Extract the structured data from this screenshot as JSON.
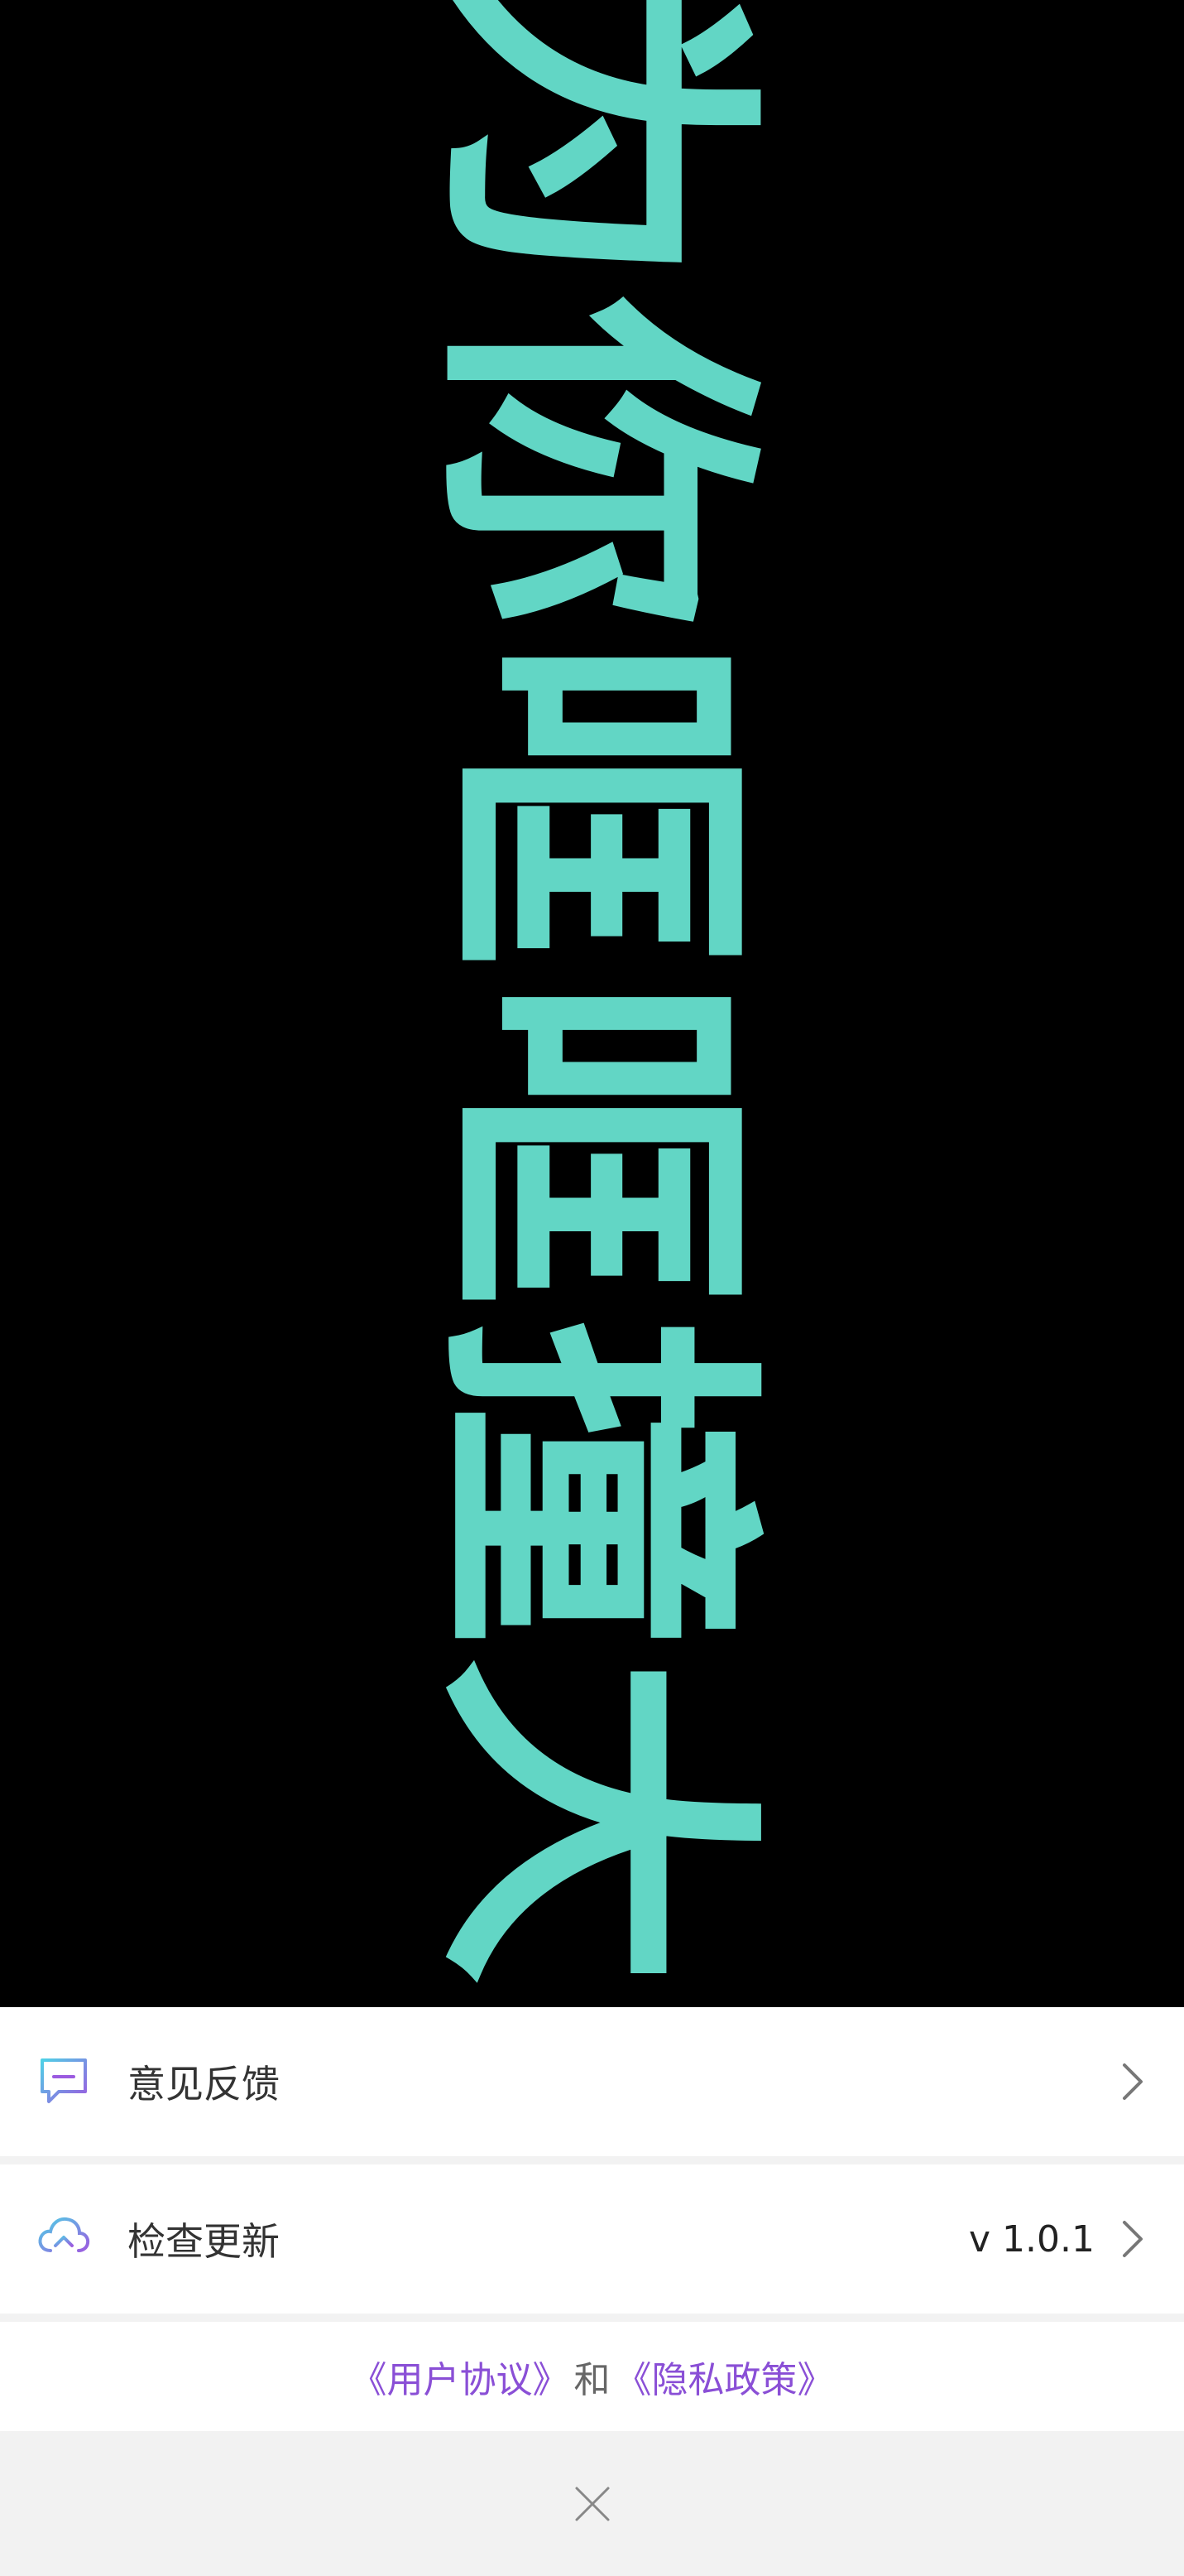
{
  "banner": {
    "text": "为你哐哐撞大",
    "color": "#62d6c5",
    "background": "#000000"
  },
  "menu": {
    "items": [
      {
        "label": "意见反馈",
        "icon": "feedback-chat-icon",
        "value": ""
      },
      {
        "label": "检查更新",
        "icon": "cloud-upload-icon",
        "value": "v 1.0.1"
      }
    ]
  },
  "footer": {
    "user_agreement": "《用户协议》",
    "and": "和",
    "privacy_policy": "《隐私政策》",
    "link_color": "#8a4fd6"
  },
  "close": {
    "icon": "close-icon"
  }
}
